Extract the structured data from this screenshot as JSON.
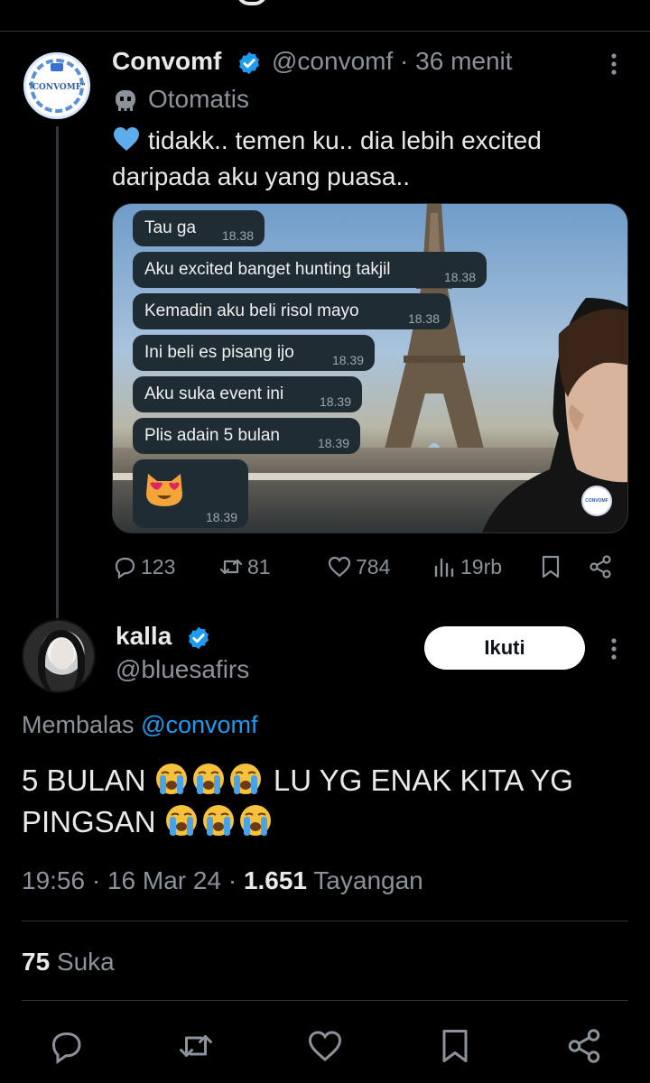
{
  "thread": {
    "original": {
      "author_name": "Convomf",
      "author_handle": "@convomf",
      "time_separator": "·",
      "time_ago": "36 menit",
      "automated_label": "Otomatis",
      "avatar_text": "\"CONVOMF\"",
      "text": "tidakk.. temen ku.. dia lebih excited daripada aku yang puasa..",
      "leading_emoji": "blue-heart",
      "image": {
        "bubbles": [
          {
            "text": "Tau ga",
            "time": "18.38"
          },
          {
            "text": "Aku excited banget hunting takjil",
            "time": "18.38"
          },
          {
            "text": "Kemadin aku beli risol mayo",
            "time": "18.38"
          },
          {
            "text": "Ini beli es pisang ijo",
            "time": "18.39"
          },
          {
            "text": "Aku suka event ini",
            "time": "18.39"
          },
          {
            "text": "Plis adain 5 bulan",
            "time": "18.39"
          },
          {
            "emoji": "heart-eyes-cat",
            "time": "18.39"
          }
        ],
        "watermark": "CONVOMF"
      },
      "actions": {
        "replies": "123",
        "reposts": "81",
        "likes": "784",
        "views": "19rb"
      }
    },
    "reply": {
      "author_name": "kalla",
      "author_handle": "@bluesafirs",
      "follow_label": "Ikuti",
      "replying_prefix": "Membalas",
      "replying_to": "@convomf",
      "text_part1": "5 BULAN",
      "text_part2": "LU YG ENAK KITA YG",
      "text_part3": "PINGSAN",
      "emoji": "loudly-crying-face",
      "time": "19:56",
      "date": "16 Mar 24",
      "views_count": "1.651",
      "views_label": "Tayangan",
      "likes_count": "75",
      "likes_label": "Suka"
    }
  },
  "colors": {
    "background": "#000000",
    "text": "#e7e9ea",
    "muted": "#8b9299",
    "accent": "#1d9bf0"
  }
}
